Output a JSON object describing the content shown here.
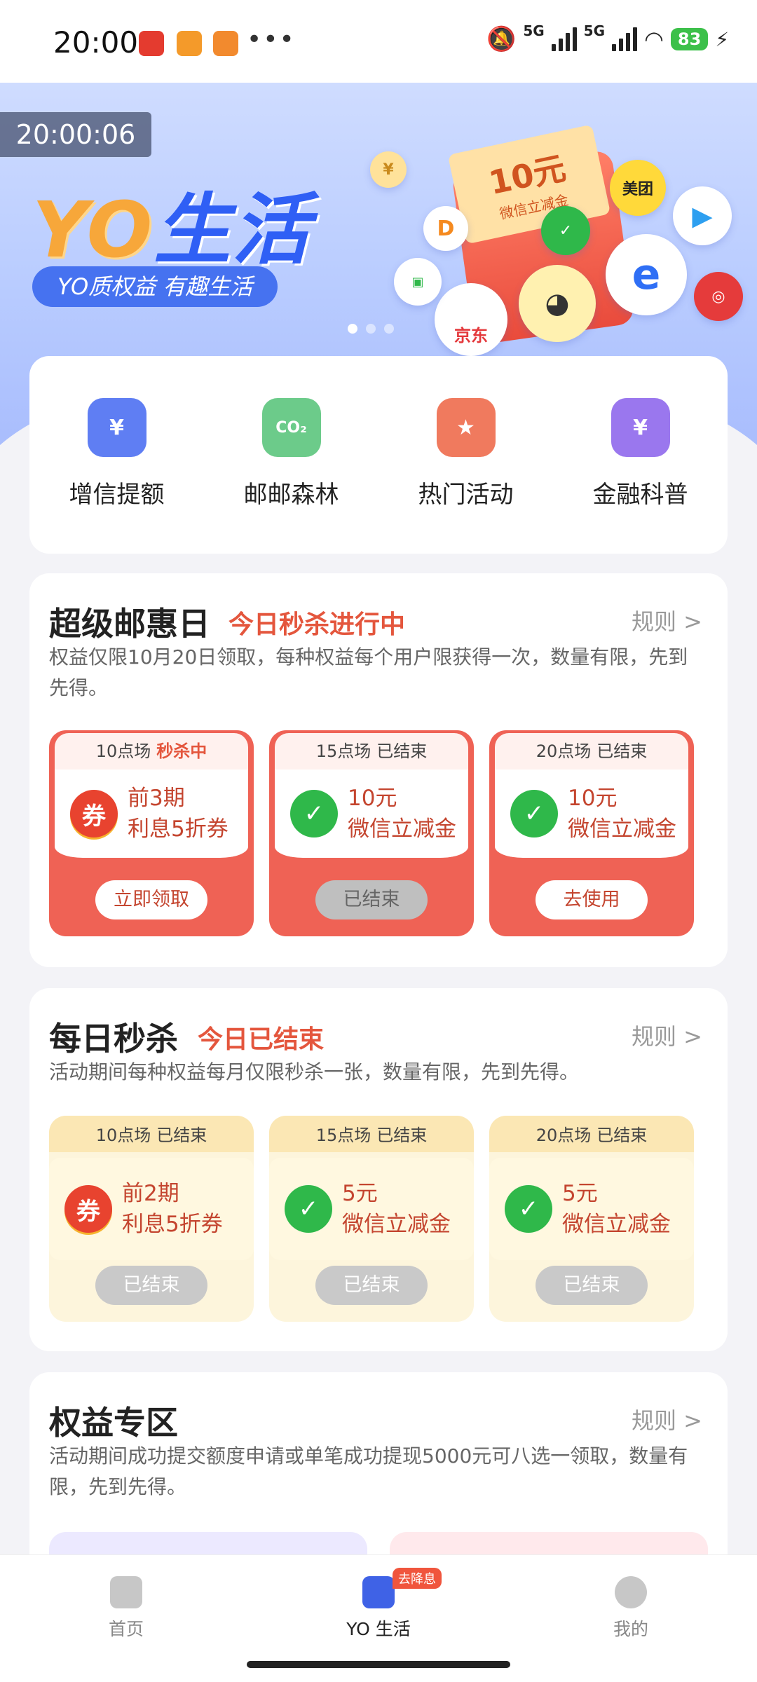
{
  "status_bar": {
    "time": "20:00",
    "signal_1": "5G",
    "signal_2": "5G",
    "battery": "83"
  },
  "banner": {
    "timer": "20:00:06",
    "title_yo": "YO",
    "title_life": "生活",
    "subtitle": "YO质权益 有趣生活",
    "coupon_amount": "10元",
    "coupon_label": "微信立减金",
    "brand_meituan": "美团",
    "brand_jd": "京东"
  },
  "quick_menu": [
    {
      "label": "增信提额",
      "icon": "wallet-icon",
      "color": "#5f7ef3"
    },
    {
      "label": "邮邮森林",
      "icon": "co2-cloud-icon",
      "color": "#6ccb8a"
    },
    {
      "label": "热门活动",
      "icon": "bookmark-star-icon",
      "color": "#f07a5e"
    },
    {
      "label": "金融科普",
      "icon": "search-doc-icon",
      "color": "#9a77ee"
    }
  ],
  "super_day": {
    "title": "超级邮惠日",
    "status": "今日秒杀进行中",
    "rule": "规则 >",
    "desc": "权益仅限10月20日领取，每种权益每个用户限获得一次，数量有限，先到先得。",
    "tickets": [
      {
        "session": "10点场",
        "state": "秒杀中",
        "line1": "前3期",
        "line2": "利息5折券",
        "icon": "券",
        "button": "立即领取"
      },
      {
        "session": "15点场",
        "state": "已结束",
        "line1": "10元",
        "line2": "微信立减金",
        "icon": "wechat-icon",
        "button": "已结束"
      },
      {
        "session": "20点场",
        "state": "已结束",
        "line1": "10元",
        "line2": "微信立减金",
        "icon": "wechat-icon",
        "button": "去使用"
      }
    ]
  },
  "daily_flash": {
    "title": "每日秒杀",
    "status": "今日已结束",
    "rule": "规则 >",
    "desc": "活动期间每种权益每月仅限秒杀一张，数量有限，先到先得。",
    "tickets": [
      {
        "session": "10点场",
        "state": "已结束",
        "line1": "前2期",
        "line2": "利息5折券",
        "icon": "券",
        "button": "已结束"
      },
      {
        "session": "15点场",
        "state": "已结束",
        "line1": "5元",
        "line2": "微信立减金",
        "icon": "wechat-icon",
        "button": "已结束"
      },
      {
        "session": "20点场",
        "state": "已结束",
        "line1": "5元",
        "line2": "微信立减金",
        "icon": "wechat-icon",
        "button": "已结束"
      }
    ]
  },
  "benefits": {
    "title": "权益专区",
    "rule": "规则 >",
    "desc": "活动期间成功提交额度申请或单笔成功提现5000元可八选一领取，数量有限，先到先得。"
  },
  "bottom_nav": [
    {
      "label": "首页",
      "icon": "home-icon"
    },
    {
      "label": "YO 生活",
      "icon": "bag-star-icon",
      "badge": "去降息"
    },
    {
      "label": "我的",
      "icon": "user-icon"
    }
  ]
}
